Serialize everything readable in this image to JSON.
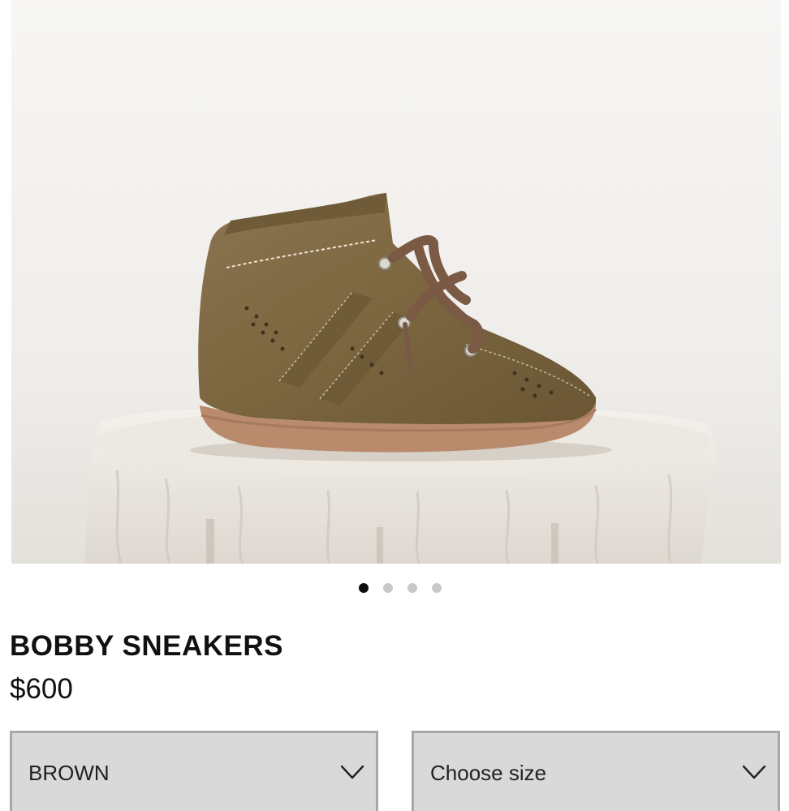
{
  "gallery": {
    "image_alt": "Bobby sneakers product photo",
    "dots": [
      {
        "active": true
      },
      {
        "active": false
      },
      {
        "active": false
      },
      {
        "active": false
      }
    ]
  },
  "product": {
    "title": "BOBBY SNEAKERS",
    "price": "$600"
  },
  "selectors": {
    "color": {
      "value": "BROWN",
      "icon": "chevron-down-icon"
    },
    "size": {
      "value": "Choose size",
      "icon": "chevron-down-icon"
    }
  },
  "colors": {
    "suede": "#7f6a44",
    "sole": "#b98a6c",
    "background": "#f1efec"
  }
}
